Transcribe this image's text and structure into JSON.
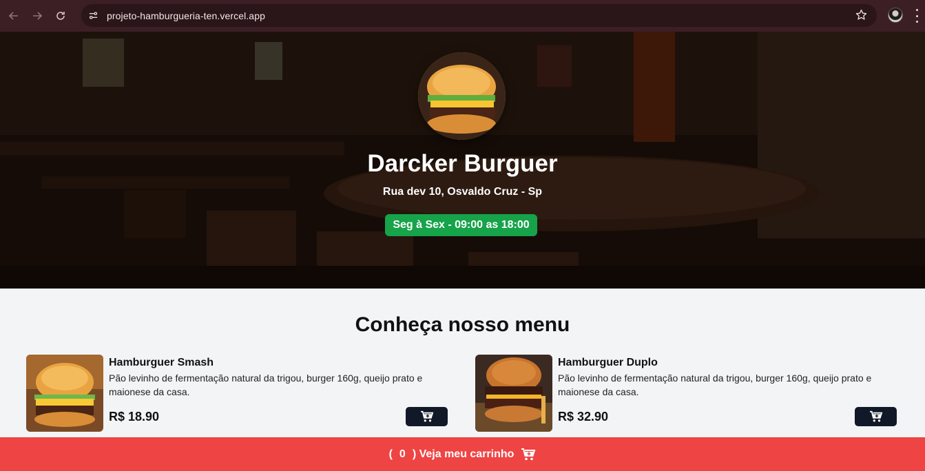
{
  "browser": {
    "url": "projeto-hamburgueria-ten.vercel.app",
    "icons": [
      "back-icon",
      "forward-icon",
      "reload-icon",
      "site-info-icon",
      "bookmark-star-icon",
      "profile-avatar",
      "menu-dots-icon"
    ]
  },
  "hero": {
    "title": "Darcker Burguer",
    "address": "Rua dev 10, Osvaldo Cruz - Sp",
    "hours": "Seg à Sex - 09:00 as 18:00"
  },
  "menu": {
    "title": "Conheça nosso menu",
    "items": [
      {
        "name": "Hamburguer Smash",
        "description": "Pão levinho de fermentação natural da trigou, burger 160g, queijo prato e maionese da casa.",
        "price": "R$ 18.90"
      },
      {
        "name": "Hamburguer Duplo",
        "description": "Pão levinho de fermentação natural da trigou, burger 160g, queijo prato e maionese da casa.",
        "price": "R$ 32.90"
      }
    ]
  },
  "cart": {
    "open_paren": "(",
    "count": "0",
    "label": ") Veja meu carrinho"
  },
  "colors": {
    "hours_badge": "#16a34a",
    "cart_bar": "#ef4444",
    "cart_button": "#111827"
  }
}
